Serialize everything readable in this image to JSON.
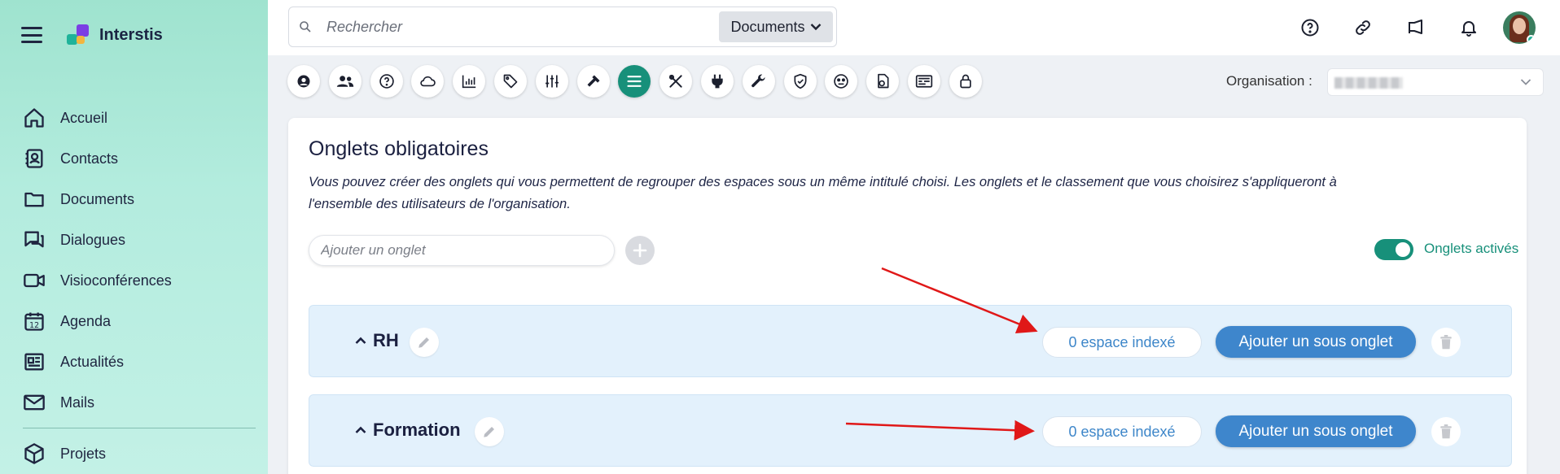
{
  "app": {
    "name": "Interstis"
  },
  "search": {
    "placeholder": "Rechercher",
    "scope": "Documents"
  },
  "sidebar": {
    "items": [
      {
        "label": "Accueil",
        "icon": "home-icon"
      },
      {
        "label": "Contacts",
        "icon": "contacts-icon"
      },
      {
        "label": "Documents",
        "icon": "folder-icon"
      },
      {
        "label": "Dialogues",
        "icon": "chat-icon"
      },
      {
        "label": "Visioconférences",
        "icon": "video-icon"
      },
      {
        "label": "Agenda",
        "icon": "calendar-icon"
      },
      {
        "label": "Actualités",
        "icon": "news-icon"
      },
      {
        "label": "Mails",
        "icon": "mail-icon"
      },
      {
        "label": "Projets",
        "icon": "box-icon"
      }
    ]
  },
  "topbar": {
    "icons": [
      "help-icon",
      "link-icon",
      "megaphone-icon",
      "bell-icon",
      "avatar"
    ]
  },
  "toolbar": {
    "icons": [
      "user-circle-icon",
      "users-icon",
      "help-circle-icon",
      "cloud-icon",
      "chart-icon",
      "tag-icon",
      "sliders-icon",
      "hammer-icon",
      "list-icon",
      "tools-icon",
      "plug-icon",
      "wrench-icon",
      "shield-icon",
      "face-icon",
      "file-gear-icon",
      "dashboard-icon",
      "lock-icon"
    ],
    "active_index": 8
  },
  "organisation": {
    "label": "Organisation :"
  },
  "card": {
    "title": "Onglets obligatoires",
    "description": "Vous pouvez créer des onglets qui vous permettent de regrouper des espaces sous un même intitulé choisi. Les onglets et le classement que vous choisirez s'appliqueront à l'ensemble des utilisateurs de l'organisation.",
    "add_placeholder": "Ajouter un onglet",
    "toggle_label": "Onglets activés",
    "tabs": [
      {
        "name": "RH",
        "count_label": "0 espace indexé",
        "add_label": "Ajouter un sous onglet"
      },
      {
        "name": "Formation",
        "count_label": "0 espace indexé",
        "add_label": "Ajouter un sous onglet"
      }
    ]
  },
  "colors": {
    "accent": "#17907a",
    "primary_button": "#3e86cc",
    "row_bg": "#e3f1fc",
    "arrow": "#e01818"
  }
}
